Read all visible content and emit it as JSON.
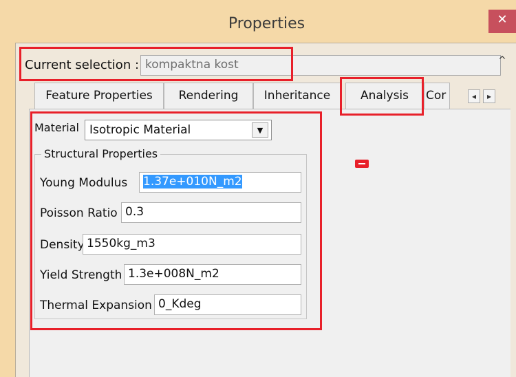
{
  "window": {
    "title": "Properties",
    "close_symbol": "✕"
  },
  "selection": {
    "label": "Current selection :",
    "value": "kompaktna kost"
  },
  "tabs": [
    {
      "label": "Feature Properties"
    },
    {
      "label": "Rendering"
    },
    {
      "label": "Inheritance"
    },
    {
      "label": "Analysis",
      "active": true
    },
    {
      "label": "Cor"
    }
  ],
  "tab_nav": {
    "prev": "◂",
    "next": "▸"
  },
  "material": {
    "label": "Material",
    "value": "Isotropic Material",
    "arrow": "▼"
  },
  "structural": {
    "legend": "Structural Properties",
    "young_label": "Young Modulus",
    "young_value": "1.37e+010N_m2",
    "poisson_label": "Poisson Ratio",
    "poisson_value": "0.3",
    "density_label": "Density",
    "density_value": "1550kg_m3",
    "yield_label": "Yield Strength",
    "yield_value": "1.3e+008N_m2",
    "thermal_label": "Thermal Expansion",
    "thermal_value": "0_Kdeg"
  },
  "colors": {
    "highlight_box": "#e8202a",
    "title_bg": "#f5d9a8",
    "selection_blue": "#3399ff"
  },
  "icons": {
    "close": "close-icon",
    "scroll_up": "chevron-up-icon",
    "dropdown": "chevron-down-icon"
  }
}
